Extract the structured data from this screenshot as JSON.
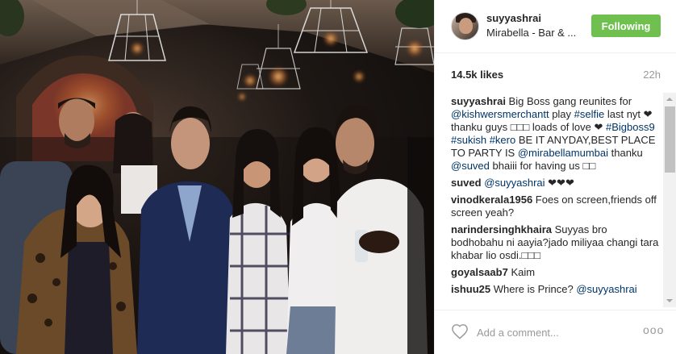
{
  "post": {
    "photo_alt": "group photo"
  },
  "header": {
    "username": "suyyashrai",
    "location": "Mirabella - Bar & ...",
    "follow_label": "Following"
  },
  "meta": {
    "likes": "14.5k likes",
    "time": "22h"
  },
  "comments": [
    {
      "user": "suyyashrai",
      "parts": [
        {
          "t": " Big Boss gang reunites for "
        },
        {
          "t": "@kishwersmerchantt",
          "link": true
        },
        {
          "t": " play "
        },
        {
          "t": "#selfie",
          "link": true
        },
        {
          "t": " last nyt ❤ thanku guys □□□ loads of love ❤ "
        },
        {
          "t": "#Bigboss9",
          "link": true
        },
        {
          "t": " "
        },
        {
          "t": "#sukish",
          "link": true
        },
        {
          "t": " "
        },
        {
          "t": "#kero",
          "link": true
        },
        {
          "t": " BE IT ANYDAY,BEST PLACE TO PARTY IS "
        },
        {
          "t": "@mirabellamumbai",
          "link": true
        },
        {
          "t": " thanku "
        },
        {
          "t": "@suved",
          "link": true
        },
        {
          "t": " bhaiii for having us □□"
        }
      ]
    },
    {
      "user": "suved",
      "parts": [
        {
          "t": " "
        },
        {
          "t": "@suyyashrai",
          "link": true
        },
        {
          "t": " ❤❤❤"
        }
      ]
    },
    {
      "user": "vinodkerala1956",
      "parts": [
        {
          "t": " Foes on screen,friends off screen yeah?"
        }
      ]
    },
    {
      "user": "narindersinghkhaira",
      "parts": [
        {
          "t": " Suyyas bro bodhobahu ni aayia?jado miliyaa changi tara khabar lio osdi.□□□"
        }
      ]
    },
    {
      "user": "goyalsaab7",
      "parts": [
        {
          "t": " Kaim"
        }
      ]
    },
    {
      "user": "ishuu25",
      "parts": [
        {
          "t": " Where is Prince? "
        },
        {
          "t": "@suyyashrai",
          "link": true
        }
      ]
    }
  ],
  "footer": {
    "add_comment_placeholder": "Add a comment...",
    "more_label": "ooo"
  },
  "colors": {
    "follow_green": "#70c050",
    "link_blue": "#003569",
    "text": "#262626",
    "muted": "#999999"
  },
  "icons": {
    "like": "heart-outline-icon",
    "more": "more-options-icon"
  }
}
